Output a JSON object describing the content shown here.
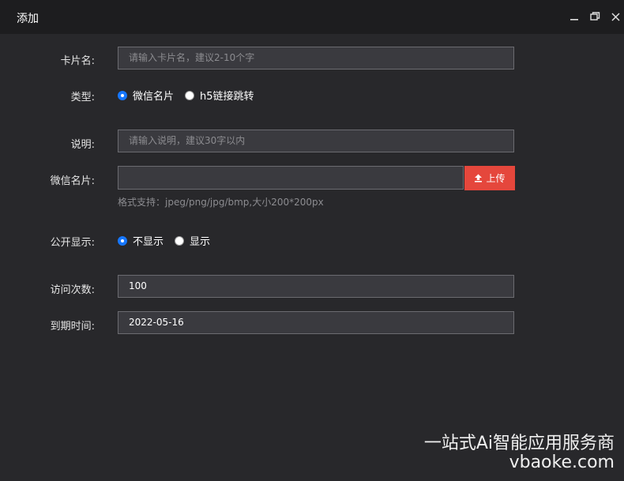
{
  "window": {
    "title": "添加",
    "minimize_icon": "minimize-icon",
    "maximize_icon": "restore-icon",
    "close_icon": "close-icon"
  },
  "form": {
    "card_name": {
      "label": "卡片名:",
      "placeholder": "请输入卡片名，建议2-10个字",
      "value": ""
    },
    "type": {
      "label": "类型:",
      "options": [
        "微信名片",
        "h5链接跳转"
      ],
      "selected": "微信名片"
    },
    "description": {
      "label": "说明:",
      "placeholder": "请输入说明，建议30字以内",
      "value": ""
    },
    "wechat_card": {
      "label": "微信名片:",
      "upload_label": "上传",
      "upload_icon": "upload-icon",
      "hint": "格式支持：jpeg/png/jpg/bmp,大小200*200px"
    },
    "public_display": {
      "label": "公开显示:",
      "options": [
        "不显示",
        "显示"
      ],
      "selected": "不显示"
    },
    "visit_count": {
      "label": "访问次数:",
      "value": "100"
    },
    "expiry_date": {
      "label": "到期时间:",
      "value": "2022-05-16"
    }
  },
  "watermark": {
    "line1": "一站式Ai智能应用服务商",
    "line2": "vbaoke.com"
  },
  "colors": {
    "background": "#28282b",
    "titlebar": "#1d1d1f",
    "accent_radio": "#1677ff",
    "upload_button": "#e5473c"
  }
}
